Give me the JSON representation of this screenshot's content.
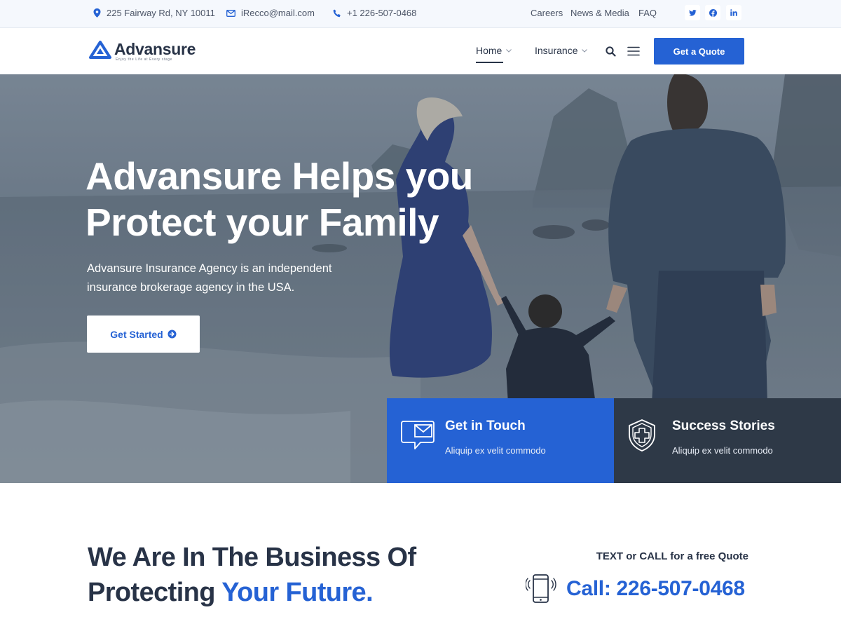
{
  "topbar": {
    "address": "225 Fairway Rd, NY 10011",
    "email": "iRecco@mail.com",
    "phone": "+1 226-507-0468",
    "links": [
      "Careers",
      "News & Media",
      "FAQ"
    ],
    "social": [
      "twitter-icon",
      "facebook-icon",
      "linkedin-icon"
    ]
  },
  "header": {
    "logo_name": "Advansure",
    "logo_tagline": "Enjoy the Life at Every stage",
    "nav": [
      {
        "label": "Home",
        "active": true
      },
      {
        "label": "Insurance",
        "active": false
      }
    ],
    "quote_button": "Get a Quote"
  },
  "hero": {
    "title_line1": "Advansure Helps you",
    "title_line2": "Protect your Family",
    "subtitle": "Advansure Insurance Agency is an independent insurance brokerage agency in the USA.",
    "button": "Get Started"
  },
  "cards": [
    {
      "title": "Get in Touch",
      "text": "Aliquip ex velit commodo",
      "icon": "chat-mail-icon"
    },
    {
      "title": "Success Stories",
      "text": "Aliquip ex velit commodo",
      "icon": "shield-plus-icon"
    }
  ],
  "business": {
    "line1": "We Are In The Business Of",
    "line2_plain": "Protecting ",
    "line2_accent": "Your Future.",
    "cta_label": "TEXT or CALL for a free Quote",
    "cta_phone": "Call: 226-507-0468"
  },
  "colors": {
    "accent": "#2562d4",
    "dark": "#2e3947",
    "text": "#283347",
    "topbar_bg": "#f5f8fd"
  }
}
